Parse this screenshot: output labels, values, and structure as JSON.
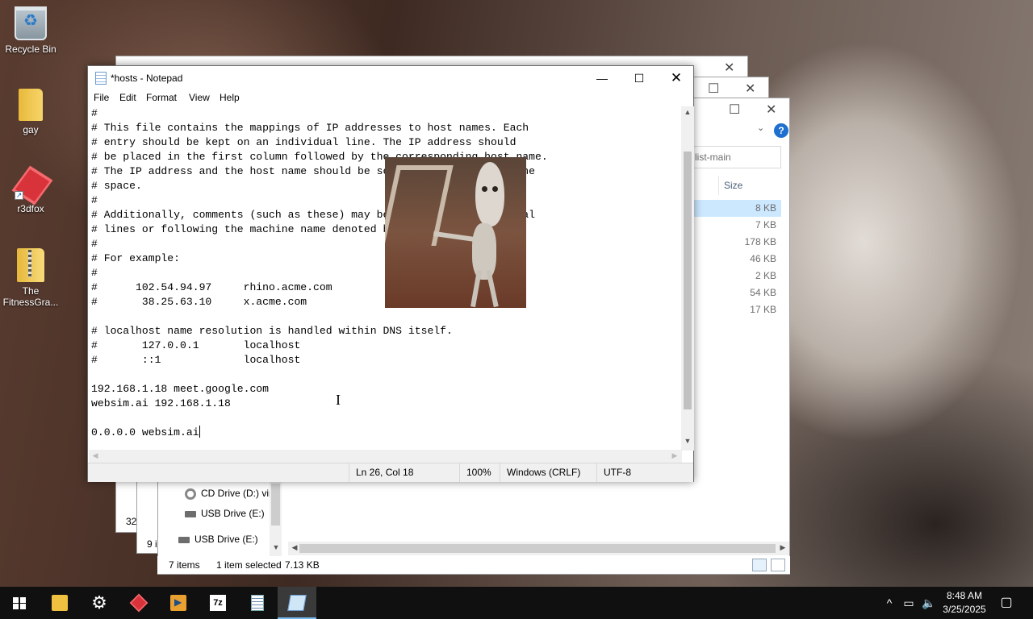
{
  "desktop": {
    "icons": [
      {
        "label": "Recycle Bin"
      },
      {
        "label": "gay"
      },
      {
        "label": "r3dfox"
      },
      {
        "label": "The FitnessGra..."
      }
    ]
  },
  "explorer": {
    "search_placeholder": "list-main",
    "size_header": "Size",
    "sizes": [
      "8 KB",
      "7 KB",
      "178 KB",
      "46 KB",
      "2 KB",
      "54 KB",
      "17 KB"
    ],
    "selected_index": 0,
    "nav": {
      "cd_drive": "CD Drive (D:) virt",
      "usb_drive_1": "USB Drive (E:)",
      "usb_drive_2": "USB Drive (E:)"
    },
    "status": {
      "items": "7 items",
      "selected": "1 item selected",
      "selected_size": "7.13 KB"
    },
    "peek_left_1": "32",
    "peek_left_2": "9 i"
  },
  "notepad": {
    "title": "*hosts - Notepad",
    "menu": [
      "File",
      "Edit",
      "Format",
      "View",
      "Help"
    ],
    "content": "#\n# This file contains the mappings of IP addresses to host names. Each\n# entry should be kept on an individual line. The IP address should\n# be placed in the first column followed by the corresponding host name.\n# The IP address and the host name should be separated by at least one\n# space.\n#\n# Additionally, comments (such as these) may be inserted on individual\n# lines or following the machine name denoted by a '#' symbol.\n#\n# For example:\n#\n#      102.54.94.97     rhino.acme.com\n#       38.25.63.10     x.acme.com\n\n# localhost name resolution is handled within DNS itself.\n#\t127.0.0.1       localhost\n#\t::1             localhost\n\n192.168.1.18 meet.google.com\nwebsim.ai 192.168.1.18\n\n0.0.0.0 websim.ai",
    "status": {
      "position": "Ln 26, Col 18",
      "zoom": "100%",
      "line_ending": "Windows (CRLF)",
      "encoding": "UTF-8"
    }
  },
  "taskbar": {
    "apps": [
      "start-icon",
      "file-explorer-icon",
      "settings-gear-icon",
      "r3dfox-icon",
      "media-player-icon",
      "7zip-icon",
      "document-icon",
      "notepad-icon"
    ],
    "active_app": "notepad-icon",
    "clock": {
      "time": "8:48 AM",
      "date": "3/25/2025"
    }
  }
}
